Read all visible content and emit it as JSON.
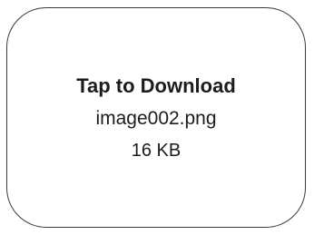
{
  "attachment": {
    "action_label": "Tap to Download",
    "file_name": "image002.png",
    "file_size": "16 KB"
  },
  "colors": {
    "text": "#1c1c1e",
    "border": "#3a3a3a",
    "background": "#ffffff"
  }
}
